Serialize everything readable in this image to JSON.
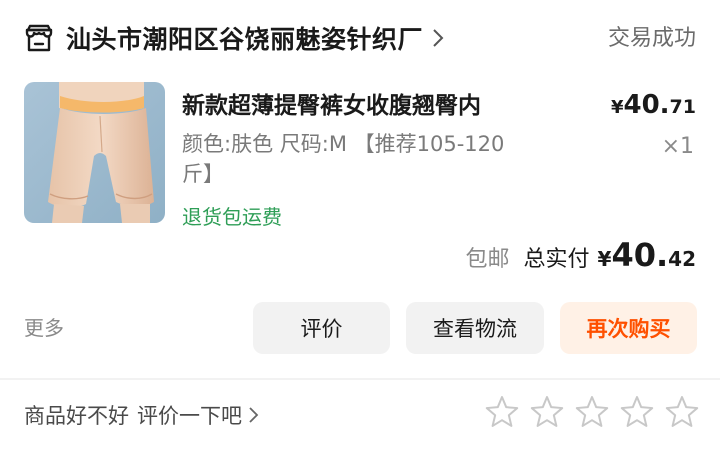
{
  "shop": {
    "name": "汕头市潮阳区谷饶丽魅姿针织厂",
    "status": "交易成功"
  },
  "item": {
    "title": "新款超薄提臀裤女收腹翘臀内",
    "spec_line1": "颜色:肤色 尺码:M 【推荐105-120",
    "spec_line2": "斤】",
    "tag": "退货包运费",
    "unit_price_currency": "¥",
    "unit_price_int": "40.",
    "unit_price_dec": "71",
    "quantity": "×1"
  },
  "totals": {
    "shipping": "包邮",
    "label": "总实付",
    "currency": "¥",
    "int": "40.",
    "dec": "42"
  },
  "actions": {
    "more": "更多",
    "review": "评价",
    "logistics": "查看物流",
    "rebuy": "再次购买"
  },
  "rating": {
    "prompt_a": "商品好不好",
    "prompt_b": "评价一下吧",
    "stars": 5,
    "star_color": "#c8c8c8"
  },
  "colors": {
    "accent": "#ff5000",
    "accent_bg": "#fff1e6",
    "tag_green": "#2f9e57"
  }
}
